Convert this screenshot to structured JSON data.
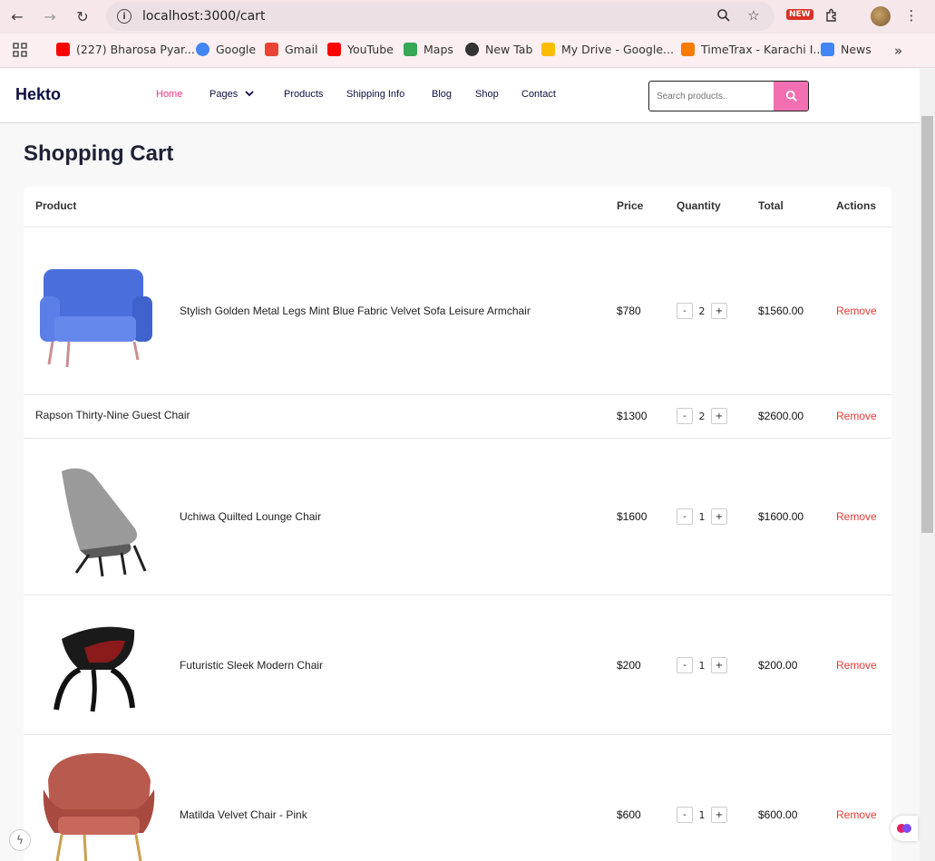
{
  "browser": {
    "url": "localhost:3000/cart",
    "new_badge": "NEW",
    "bookmarks": [
      {
        "label": "(227) Bharosa Pyar...",
        "color": "#ff0000"
      },
      {
        "label": "Google",
        "color": "#4285f4"
      },
      {
        "label": "Gmail",
        "color": "#ea4335"
      },
      {
        "label": "YouTube",
        "color": "#ff0000"
      },
      {
        "label": "Maps",
        "color": "#34a853"
      },
      {
        "label": "New Tab",
        "color": "#333333"
      },
      {
        "label": "My Drive - Google...",
        "color": "#fbbc04"
      },
      {
        "label": "TimeTrax - Karachi I...",
        "color": "#f57c00"
      },
      {
        "label": "News",
        "color": "#4285f4"
      }
    ]
  },
  "header": {
    "logo": "Hekto",
    "menu": [
      {
        "label": "Home",
        "active": true
      },
      {
        "label": "Pages",
        "active": false
      },
      {
        "label": "Products",
        "active": false
      },
      {
        "label": "Shipping Info",
        "active": false
      },
      {
        "label": "Blog",
        "active": false
      },
      {
        "label": "Shop",
        "active": false
      },
      {
        "label": "Contact",
        "active": false
      }
    ],
    "search_placeholder": "Search products..",
    "accent": "#fb2e86"
  },
  "cart": {
    "title": "Shopping Cart",
    "columns": {
      "product": "Product",
      "price": "Price",
      "quantity": "Quantity",
      "total": "Total",
      "actions": "Actions"
    },
    "items": [
      {
        "name": "Stylish Golden Metal Legs Mint Blue Fabric Velvet Sofa Leisure Armchair",
        "price": "$780",
        "qty": "2",
        "total": "$1560.00",
        "action": "Remove",
        "image": "blue-armchair"
      },
      {
        "name": "Rapson Thirty-Nine Guest Chair",
        "price": "$1300",
        "qty": "2",
        "total": "$2600.00",
        "action": "Remove",
        "image": ""
      },
      {
        "name": "Uchiwa Quilted Lounge Chair",
        "price": "$1600",
        "qty": "1",
        "total": "$1600.00",
        "action": "Remove",
        "image": "grey-lounge-chair"
      },
      {
        "name": "Futuristic Sleek Modern Chair",
        "price": "$200",
        "qty": "1",
        "total": "$200.00",
        "action": "Remove",
        "image": "black-modern-chair"
      },
      {
        "name": "Matilda Velvet Chair - Pink",
        "price": "$600",
        "qty": "1",
        "total": "$600.00",
        "action": "Remove",
        "image": "pink-velvet-chair"
      }
    ],
    "minus": "-",
    "plus": "+"
  }
}
